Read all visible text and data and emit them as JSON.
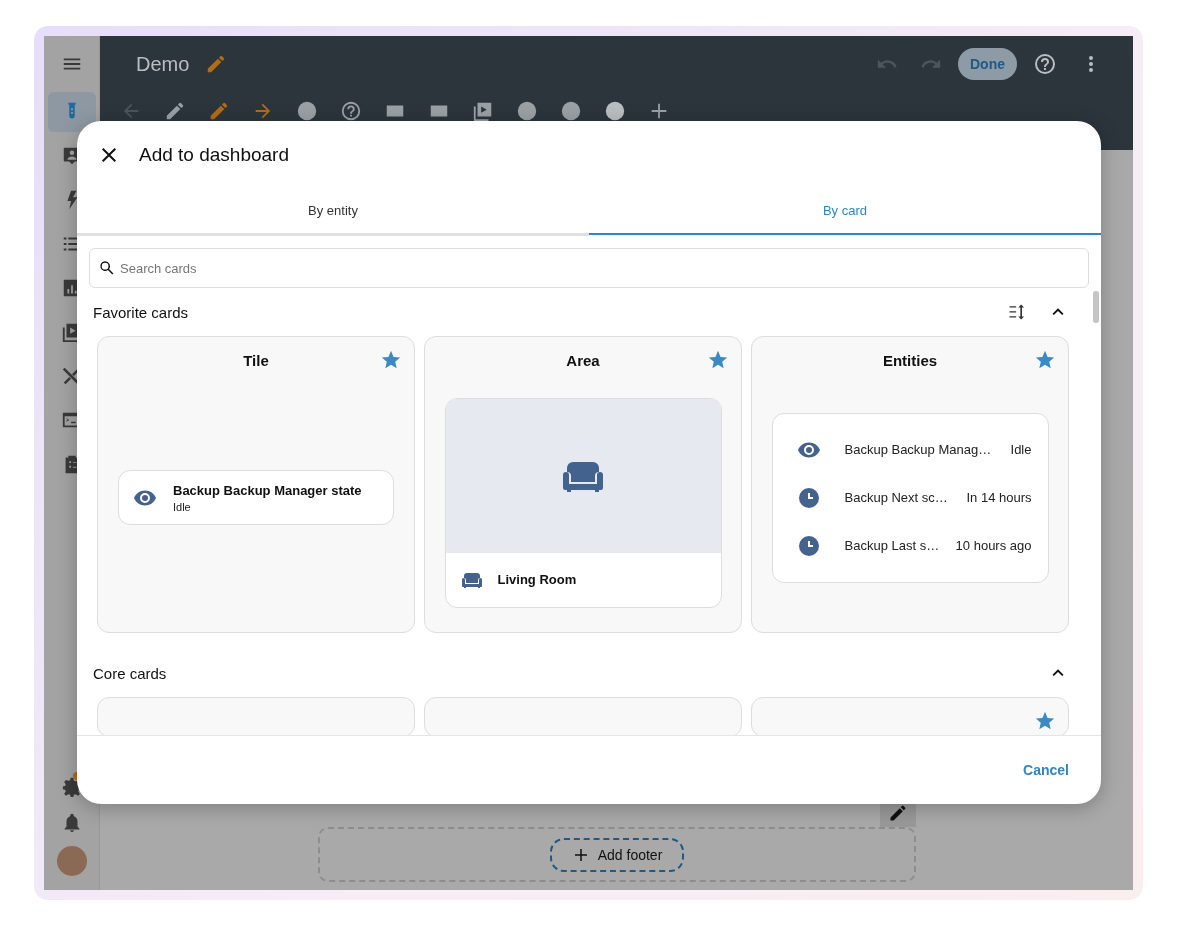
{
  "app": {
    "title": "Demo",
    "done_button": "Done"
  },
  "sidebar": {
    "items": [
      {
        "selected": true
      },
      {
        "selected": false
      },
      {
        "selected": false
      },
      {
        "selected": false
      },
      {
        "selected": false
      },
      {
        "selected": false
      },
      {
        "selected": false
      },
      {
        "selected": false
      },
      {
        "selected": false
      }
    ]
  },
  "footer_area": {
    "button": "Add footer"
  },
  "dialog": {
    "title": "Add to dashboard",
    "tabs": [
      {
        "label": "By entity",
        "selected": false
      },
      {
        "label": "By card",
        "selected": true
      }
    ],
    "search": {
      "placeholder": "Search cards"
    },
    "sections": [
      {
        "title": "Favorite cards",
        "expanded": true,
        "sortable": true,
        "cards": [
          {
            "kind": "tile",
            "title": "Tile",
            "favorite": true,
            "entity": "Backup Backup Manager state",
            "state": "Idle"
          },
          {
            "kind": "area",
            "title": "Area",
            "favorite": true,
            "area": "Living Room"
          },
          {
            "kind": "entities",
            "title": "Entities",
            "favorite": true,
            "rows": [
              {
                "kind": "state",
                "name": "Backup Backup Manag…",
                "state": "Idle"
              },
              {
                "kind": "timestamp",
                "name": "Backup Next sc…",
                "state": "In 14 hours"
              },
              {
                "kind": "timestamp",
                "name": "Backup Last s…",
                "state": "10 hours ago"
              }
            ]
          }
        ]
      },
      {
        "title": "Core cards",
        "expanded": true,
        "sortable": false,
        "cards": [
          {
            "favorite": false
          },
          {
            "favorite": false
          },
          {
            "favorite": true
          }
        ]
      }
    ],
    "cancel_button": "Cancel"
  }
}
